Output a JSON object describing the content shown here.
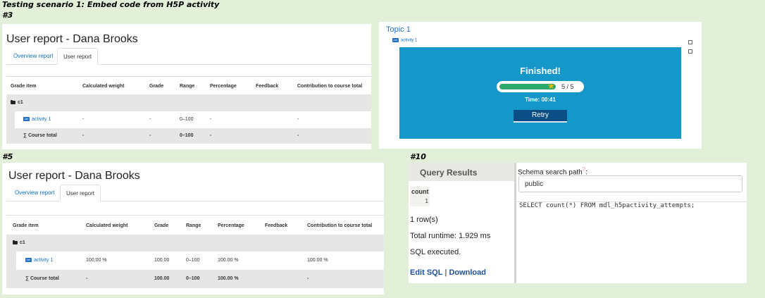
{
  "scenario_caption": "Testing scenario 1: Embed code from H5P activity",
  "step3": {
    "label": "#3",
    "title": "User report - Dana Brooks",
    "tabs": [
      "Overview report",
      "User report"
    ],
    "headers": [
      "Grade item",
      "Calculated weight",
      "Grade",
      "Range",
      "Percentage",
      "Feedback",
      "Contribution to course total"
    ],
    "category": "c1",
    "rows": [
      {
        "item": "activity 1",
        "weight": "-",
        "grade": "-",
        "range": "0–100",
        "percentage": "-",
        "feedback": "",
        "contribution": "-"
      }
    ],
    "total": {
      "item": "Course total",
      "weight": "-",
      "grade": "-",
      "range": "0–100",
      "percentage": "-",
      "feedback": "",
      "contribution": "-"
    }
  },
  "topic": {
    "title": "Topic 1",
    "activity_link": "activity 1",
    "finished": "Finished!",
    "score": "5 / 5",
    "score_fraction": 1.0,
    "time": "Time: 00:41",
    "retry": "Retry"
  },
  "step5": {
    "label": "#5",
    "title": "User report - Dana Brooks",
    "tabs": [
      "Overview report",
      "User report"
    ],
    "headers": [
      "Grade item",
      "Calculated weight",
      "Grade",
      "Range",
      "Percentage",
      "Feedback",
      "Contribution to course total"
    ],
    "category": "c1",
    "rows": [
      {
        "item": "activity 1",
        "weight": "100.00 %",
        "grade": "100.00",
        "range": "0–100",
        "percentage": "100.00 %",
        "feedback": "",
        "contribution": "100.00 %"
      }
    ],
    "total": {
      "item": "Course total",
      "weight": "-",
      "grade": "100.00",
      "range": "0–100",
      "percentage": "100.00 %",
      "feedback": "",
      "contribution": "-"
    }
  },
  "step10": {
    "label": "#10",
    "query_results_title": "Query Results",
    "column": "count",
    "value": "1",
    "rows_text": "1 row(s)",
    "runtime": "Total runtime: 1.929 ms",
    "executed": "SQL executed.",
    "edit_sql": "Edit SQL",
    "separator": "|",
    "download": "Download",
    "schema_label": "Schema search path",
    "schema_value": "public",
    "sql": "SELECT count(*) FROM mdl_h5pactivity_attempts;"
  }
}
